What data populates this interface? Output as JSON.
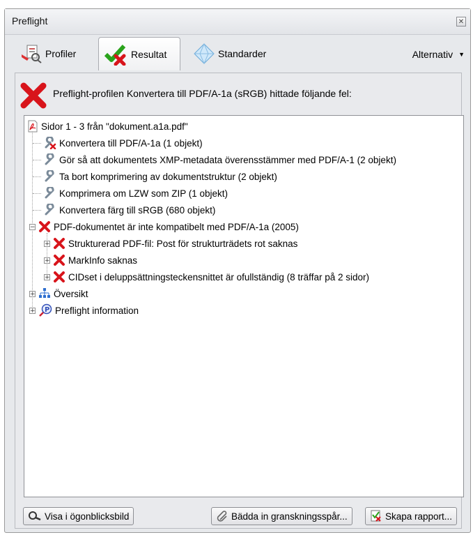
{
  "window": {
    "title": "Preflight"
  },
  "tabs": [
    {
      "label": "Profiler",
      "icon": "profiles-icon"
    },
    {
      "label": "Resultat",
      "icon": "results-icon"
    },
    {
      "label": "Standarder",
      "icon": "standards-icon"
    }
  ],
  "options_label": "Alternativ",
  "summary": {
    "message": "Preflight-profilen Konvertera till PDF/A-1a (sRGB) hittade följande fel:"
  },
  "tree": {
    "root": "Sidor 1 - 3 från \"dokument.a1a.pdf\"",
    "fixups": [
      "Konvertera till PDF/A-1a (1 objekt)",
      "Gör så att dokumentets XMP-metadata överensstämmer med PDF/A-1 (2 objekt)",
      "Ta bort komprimering av dokumentstruktur (2 objekt)",
      "Komprimera om LZW som ZIP (1 objekt)",
      "Konvertera färg till sRGB (680 objekt)"
    ],
    "error_group": "PDF-dokumentet är inte kompatibelt med PDF/A-1a (2005)",
    "errors": [
      "Strukturerad PDF-fil: Post för strukturträdets rot saknas",
      "MarkInfo saknas",
      "CIDset i deluppsättningsteckensnittet är ofullständig (8 träffar på 2 sidor)"
    ],
    "overview": "Översikt",
    "info": "Preflight information"
  },
  "buttons": {
    "snapshot": "Visa i ögonblicksbild",
    "embed": "Bädda in granskningsspår...",
    "report": "Skapa rapport..."
  },
  "colors": {
    "error_red": "#d8141b",
    "accent_green": "#2aa31c"
  }
}
